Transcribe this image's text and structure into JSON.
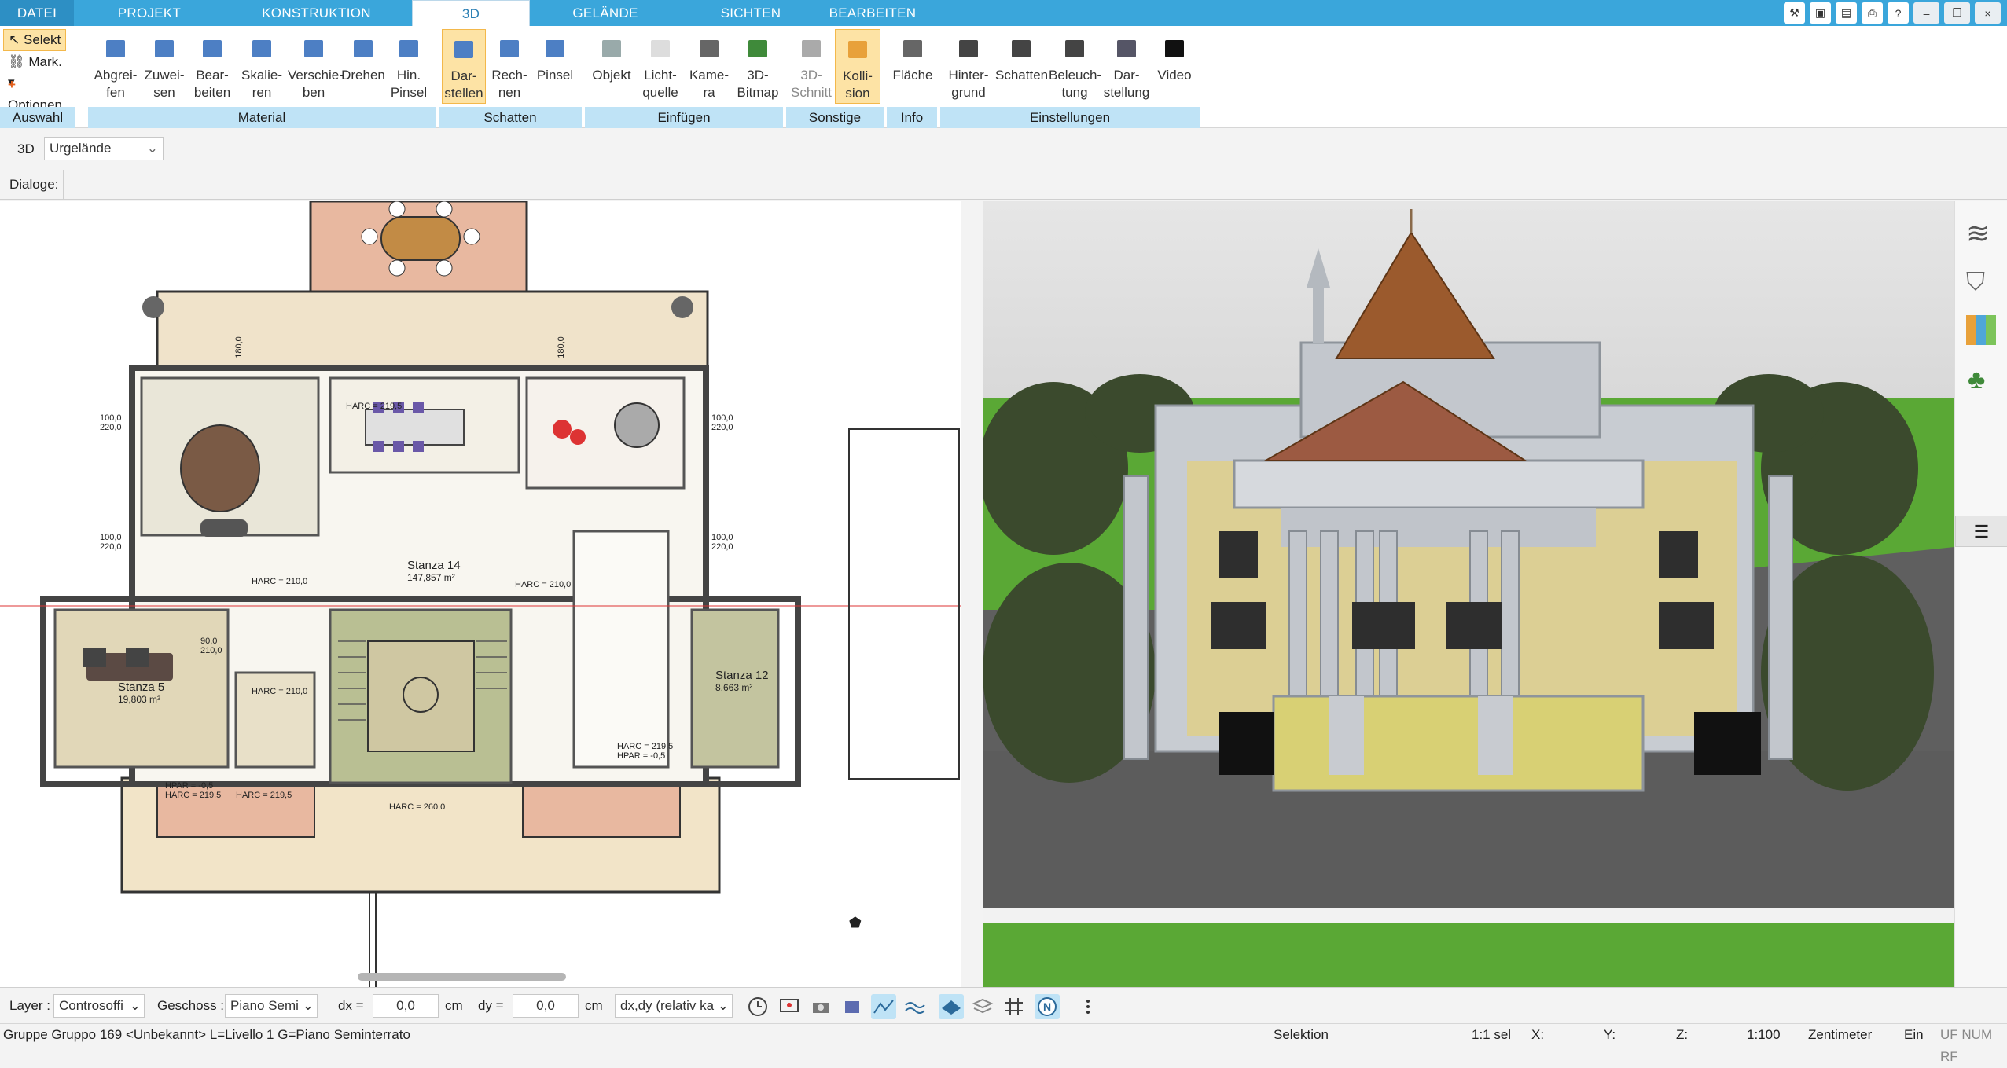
{
  "tabs": [
    "DATEI",
    "PROJEKT",
    "KONSTRUKTION",
    "3D",
    "GELÄNDE",
    "SICHTEN",
    "BEARBEITEN"
  ],
  "ribbon": {
    "auswahl": {
      "selekt": "Selekt",
      "mark": "Mark.",
      "optionen": "Optionen",
      "footer": "Auswahl"
    },
    "material": {
      "footer": "Material",
      "buttons": [
        [
          "Abgrei-",
          "fen"
        ],
        [
          "Zuwei-",
          "sen"
        ],
        [
          "Bear-",
          "beiten"
        ],
        [
          "Skalie-",
          "ren"
        ],
        [
          "Verschie-",
          "ben"
        ],
        [
          "Drehen",
          ""
        ],
        [
          "Hin.",
          "Pinsel"
        ]
      ]
    },
    "schatten": {
      "footer": "Schatten",
      "buttons": [
        [
          "Dar-",
          "stellen"
        ],
        [
          "Rech-",
          "nen"
        ],
        [
          "Pinsel",
          ""
        ]
      ]
    },
    "einfuegen": {
      "footer": "Einfügen",
      "buttons": [
        [
          "Objekt",
          ""
        ],
        [
          "Licht-",
          "quelle"
        ],
        [
          "Kame-",
          "ra"
        ],
        [
          "3D-",
          "Bitmap"
        ]
      ]
    },
    "sonstige": {
      "footer": "Sonstige",
      "buttons": [
        [
          "3D-",
          "Schnitt"
        ],
        [
          "Kolli-",
          "sion"
        ]
      ]
    },
    "info": {
      "footer": "Info",
      "buttons": [
        [
          "Fläche",
          ""
        ]
      ]
    },
    "einstellungen": {
      "footer": "Einstellungen",
      "buttons": [
        [
          "Hinter-",
          "grund"
        ],
        [
          "Schatten",
          ""
        ],
        [
          "Beleuch-",
          "tung"
        ],
        [
          "Dar-",
          "stellung"
        ],
        [
          "Video",
          ""
        ]
      ]
    }
  },
  "row3d": {
    "label": "3D",
    "select": "Urgelände"
  },
  "dialoge": "Dialoge:",
  "plan": {
    "rooms": [
      {
        "name": "Stanza 14",
        "area": "147,857 m²"
      },
      {
        "name": "Stanza 5",
        "area": "19,803 m²"
      },
      {
        "name": "Stanza 12",
        "area": "8,663 m²"
      }
    ],
    "dims": {
      "harc2100": "HARC = 210,0",
      "harc2195": "HARC = 219,5",
      "hpar05": "HPAR = -0,5",
      "harc2600": "HARC = 260,0",
      "d1000": "100,0",
      "d2200": "220,0",
      "d900": "90,0",
      "d1800": "180,0",
      "d2100": "210,0"
    }
  },
  "bottom": {
    "layer_label": "Layer :",
    "layer_value": "Controsoffi",
    "geschoss_label": "Geschoss :",
    "geschoss_value": "Piano Semi",
    "dx_label": "dx =",
    "dx_value": "0,0",
    "dx_unit": "cm",
    "dy_label": "dy =",
    "dy_value": "0,0",
    "dy_unit": "cm",
    "mode_value": "dx,dy (relativ ka"
  },
  "status": {
    "left": "Gruppe Gruppo 169 <Unbekannt> L=Livello 1 G=Piano Seminterrato",
    "mode": "Selektion",
    "sel": "1:1 sel",
    "x": "X:",
    "y": "Y:",
    "z": "Z:",
    "scale": "1:100",
    "unit": "Zentimeter",
    "ein": "Ein",
    "flags": "UF NUM RF"
  },
  "colors": {
    "tabbar": "#3aa6db",
    "group_footer": "#bfe3f6",
    "active_btn": "#fde3a5",
    "tab_active_text": "#2b7fb4"
  }
}
